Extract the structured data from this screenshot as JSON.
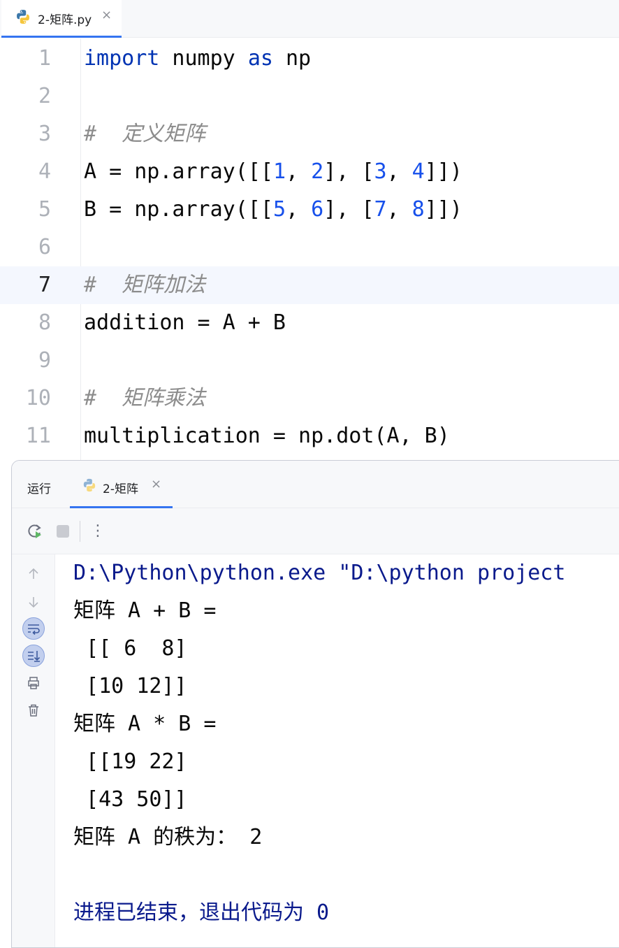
{
  "editor_tab": {
    "label": "2-矩阵.py",
    "close": "×"
  },
  "code_lines": [
    {
      "n": "1",
      "tokens": [
        {
          "t": "import",
          "k": "kw"
        },
        {
          "t": " numpy ",
          "k": "txt"
        },
        {
          "t": "as",
          "k": "kw"
        },
        {
          "t": " np",
          "k": "txt"
        }
      ]
    },
    {
      "n": "2",
      "tokens": []
    },
    {
      "n": "3",
      "tokens": [
        {
          "t": "#  定义矩阵",
          "k": "cmt"
        }
      ]
    },
    {
      "n": "4",
      "tokens": [
        {
          "t": "A = np.array([[",
          "k": "txt"
        },
        {
          "t": "1",
          "k": "num"
        },
        {
          "t": ", ",
          "k": "txt"
        },
        {
          "t": "2",
          "k": "num"
        },
        {
          "t": "], [",
          "k": "txt"
        },
        {
          "t": "3",
          "k": "num"
        },
        {
          "t": ", ",
          "k": "txt"
        },
        {
          "t": "4",
          "k": "num"
        },
        {
          "t": "]])",
          "k": "txt"
        }
      ]
    },
    {
      "n": "5",
      "tokens": [
        {
          "t": "B = np.array([[",
          "k": "txt"
        },
        {
          "t": "5",
          "k": "num"
        },
        {
          "t": ", ",
          "k": "txt"
        },
        {
          "t": "6",
          "k": "num"
        },
        {
          "t": "], [",
          "k": "txt"
        },
        {
          "t": "7",
          "k": "num"
        },
        {
          "t": ", ",
          "k": "txt"
        },
        {
          "t": "8",
          "k": "num"
        },
        {
          "t": "]])",
          "k": "txt"
        }
      ]
    },
    {
      "n": "6",
      "tokens": []
    },
    {
      "n": "7",
      "tokens": [
        {
          "t": "#  矩阵加法",
          "k": "cmt"
        }
      ],
      "current": true
    },
    {
      "n": "8",
      "tokens": [
        {
          "t": "addition = A + B",
          "k": "txt"
        }
      ]
    },
    {
      "n": "9",
      "tokens": []
    },
    {
      "n": "10",
      "tokens": [
        {
          "t": "#  矩阵乘法",
          "k": "cmt"
        }
      ]
    },
    {
      "n": "11",
      "tokens": [
        {
          "t": "multiplication = np.dot(A, B)",
          "k": "txt"
        }
      ]
    }
  ],
  "run_panel": {
    "title": "运行",
    "tab_label": "2-矩阵",
    "tab_close": "×",
    "toolbar_more": "⋮"
  },
  "console": [
    {
      "text": "D:\\Python\\python.exe \"D:\\python project",
      "kind": "sys"
    },
    {
      "text": "矩阵 A + B =",
      "kind": "out"
    },
    {
      "text": " [[ 6  8]",
      "kind": "out"
    },
    {
      "text": " [10 12]]",
      "kind": "out"
    },
    {
      "text": "矩阵 A * B =",
      "kind": "out"
    },
    {
      "text": " [[19 22]",
      "kind": "out"
    },
    {
      "text": " [43 50]]",
      "kind": "out"
    },
    {
      "text": "矩阵 A 的秩为： 2",
      "kind": "out"
    },
    {
      "text": "",
      "kind": "out"
    },
    {
      "text": "进程已结束，退出代码为 0",
      "kind": "sys"
    }
  ],
  "colors": {
    "keyword": "#0033b3",
    "number": "#1750eb",
    "comment": "#8c8c8c",
    "accent": "#3574f0",
    "system_output": "#0a1a8c"
  },
  "icons": {
    "file": "python-icon",
    "rerun": "rerun-icon",
    "stop": "stop-icon",
    "up": "arrow-up-icon",
    "down": "arrow-down-icon",
    "wrap": "soft-wrap-icon",
    "scroll": "scroll-to-end-icon",
    "print": "print-icon",
    "trash": "trash-icon"
  }
}
